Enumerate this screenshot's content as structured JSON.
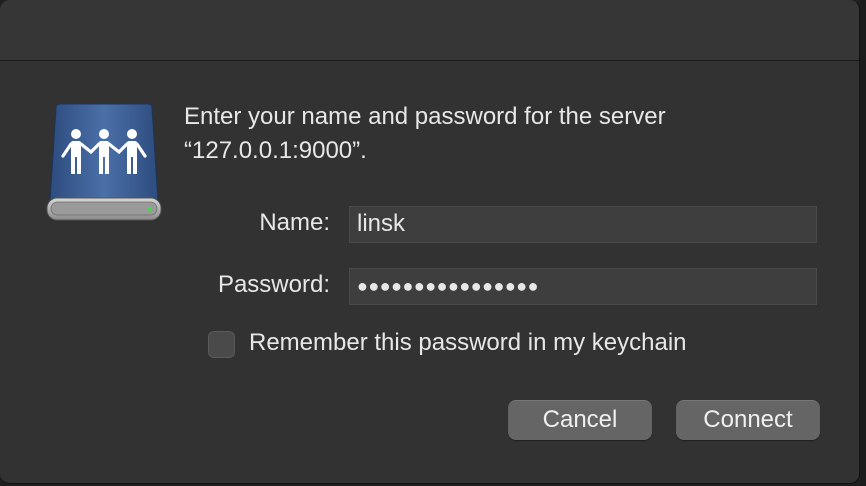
{
  "dialog": {
    "prompt_line1": "Enter your name and password for the server",
    "prompt_line2": "“127.0.0.1:9000”."
  },
  "fields": {
    "name_label": "Name:",
    "name_value": "linsk",
    "password_label": "Password:",
    "password_value": "●●●●●●●●●●●●●●●●"
  },
  "options": {
    "remember_label": "Remember this password in my keychain",
    "remember_checked": false
  },
  "buttons": {
    "cancel": "Cancel",
    "connect": "Connect"
  },
  "icons": {
    "server": "shared-server-drive-icon"
  },
  "colors": {
    "window_bg": "#323232",
    "field_bg": "#3e3e3e",
    "button_bg": "#656565",
    "drive_blue": "#3c5f95",
    "indicator_green": "#49d64a"
  }
}
